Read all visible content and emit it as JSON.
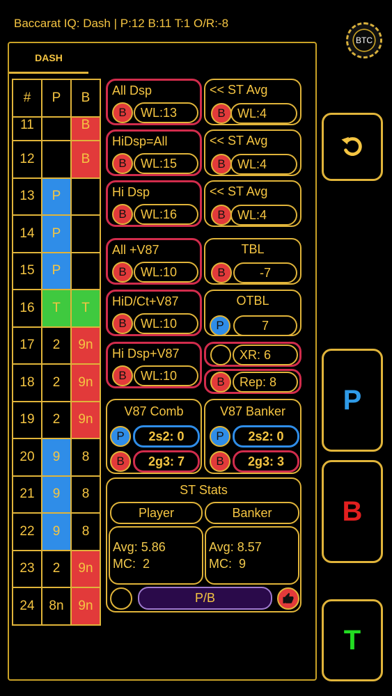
{
  "header": {
    "status": "Baccarat IQ: Dash | P:12  B:11  T:1  O/R:-8",
    "logo": "BTC"
  },
  "tabs": {
    "dash": "DASH"
  },
  "grid": {
    "headers": [
      "#",
      "P",
      "B"
    ],
    "rows": [
      {
        "n": "11",
        "p": "",
        "b": "B",
        "pc": "",
        "bc": "cb"
      },
      {
        "n": "12",
        "p": "",
        "b": "B",
        "pc": "",
        "bc": "cb"
      },
      {
        "n": "13",
        "p": "P",
        "b": "",
        "pc": "cp",
        "bc": ""
      },
      {
        "n": "14",
        "p": "P",
        "b": "",
        "pc": "cp",
        "bc": ""
      },
      {
        "n": "15",
        "p": "P",
        "b": "",
        "pc": "cp",
        "bc": ""
      },
      {
        "n": "16",
        "p": "T",
        "b": "T",
        "pc": "ct",
        "bc": "ct"
      },
      {
        "n": "17",
        "p": "2",
        "b": "9n",
        "pc": "",
        "bc": "cb"
      },
      {
        "n": "18",
        "p": "2",
        "b": "9n",
        "pc": "",
        "bc": "cb"
      },
      {
        "n": "19",
        "p": "2",
        "b": "9n",
        "pc": "",
        "bc": "cb"
      },
      {
        "n": "20",
        "p": "9",
        "b": "8",
        "pc": "cp",
        "bc": ""
      },
      {
        "n": "21",
        "p": "9",
        "b": "8",
        "pc": "cp",
        "bc": ""
      },
      {
        "n": "22",
        "p": "9",
        "b": "8",
        "pc": "cp",
        "bc": ""
      },
      {
        "n": "23",
        "p": "2",
        "b": "9n",
        "pc": "",
        "bc": "cb"
      },
      {
        "n": "24",
        "p": "8n",
        "b": "9n",
        "pc": "",
        "bc": "cb"
      }
    ]
  },
  "signals": {
    "all_dsp": {
      "label": "All Dsp",
      "bet": "B",
      "wl": "WL:13"
    },
    "st_avg_1": {
      "label": "<< ST Avg",
      "bet": "B",
      "wl": "WL:4"
    },
    "hidsp_all": {
      "label": "HiDsp=All",
      "bet": "B",
      "wl": "WL:15"
    },
    "st_avg_2": {
      "label": "<< ST Avg",
      "bet": "B",
      "wl": "WL:4"
    },
    "hi_dsp": {
      "label": "Hi Dsp",
      "bet": "B",
      "wl": "WL:16"
    },
    "st_avg_3": {
      "label": "<< ST Avg",
      "bet": "B",
      "wl": "WL:4"
    },
    "all_v87": {
      "label": "All +V87",
      "bet": "B",
      "wl": "WL:10"
    },
    "tbl": {
      "label": "TBL",
      "bet": "B",
      "value": "-7"
    },
    "hid_ct_v87": {
      "label": "HiD/Ct+V87",
      "bet": "B",
      "wl": "WL:10"
    },
    "otbl": {
      "label": "OTBL",
      "bet": "P",
      "value": "7"
    },
    "hi_dsp_v87": {
      "label": "Hi Dsp+V87",
      "bet": "B",
      "wl": "WL:10"
    },
    "xr": {
      "value": "XR: 6"
    },
    "rep": {
      "bet": "B",
      "value": "Rep: 8"
    },
    "v87_comb": {
      "label": "V87 Comb",
      "p": "P",
      "b": "B",
      "p_val": "2s2: 0",
      "b_val": "2g3: 7"
    },
    "v87_banker": {
      "label": "V87 Banker",
      "p": "P",
      "b": "B",
      "p_val": "2s2: 0",
      "b_val": "2g3: 3"
    }
  },
  "st_stats": {
    "title": "ST Stats",
    "player_btn": "Player",
    "banker_btn": "Banker",
    "player_avg": "Avg: 5.86",
    "player_mc": "MC:  2",
    "banker_avg": "Avg: 8.57",
    "banker_mc": "MC:  9",
    "pb_button": "P/B"
  },
  "buttons": {
    "undo_icon": "undo-icon",
    "player": "P",
    "banker": "B",
    "tie": "T"
  },
  "colors": {
    "gold": "#e0b43a",
    "red": "#e23a3a",
    "blue": "#2f8de8",
    "green": "#3fc93f",
    "purple": "#2a0a4a"
  }
}
